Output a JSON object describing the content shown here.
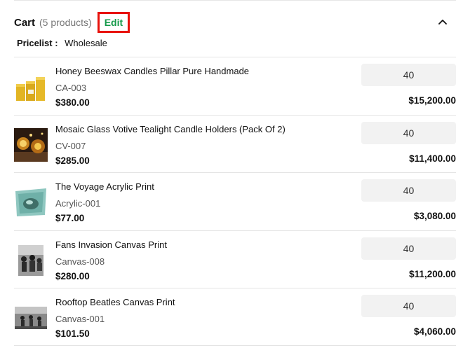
{
  "cart": {
    "title": "Cart",
    "count_label": "(5 products)",
    "edit_label": "Edit",
    "pricelist_label": "Pricelist :",
    "pricelist_value": "Wholesale"
  },
  "items": [
    {
      "name": "Honey Beeswax Candles Pillar Pure Handmade",
      "sku": "CA-003",
      "price": "$380.00",
      "qty": "40",
      "total": "$15,200.00",
      "thumb_icon": "beeswax-candles-image"
    },
    {
      "name": "Mosaic Glass Votive Tealight Candle Holders (Pack Of 2)",
      "sku": "CV-007",
      "price": "$285.00",
      "qty": "40",
      "total": "$11,400.00",
      "thumb_icon": "mosaic-candle-holders-image"
    },
    {
      "name": "The Voyage Acrylic Print",
      "sku": "Acrylic-001",
      "price": "$77.00",
      "qty": "40",
      "total": "$3,080.00",
      "thumb_icon": "voyage-acrylic-print-image"
    },
    {
      "name": "Fans Invasion Canvas Print",
      "sku": "Canvas-008",
      "price": "$280.00",
      "qty": "40",
      "total": "$11,200.00",
      "thumb_icon": "fans-invasion-canvas-image"
    },
    {
      "name": "Rooftop Beatles Canvas Print",
      "sku": "Canvas-001",
      "price": "$101.50",
      "qty": "40",
      "total": "$4,060.00",
      "thumb_icon": "rooftop-beatles-canvas-image"
    }
  ],
  "colors": {
    "edit": "#159a4a",
    "highlight_border": "#e8120c",
    "qty_bg": "#f2f2f2"
  }
}
